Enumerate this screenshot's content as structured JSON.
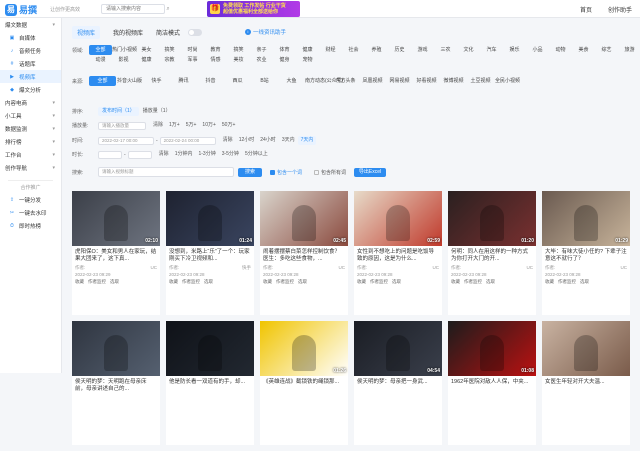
{
  "header": {
    "logo_text": "易撰",
    "slogan": "让创作更高效",
    "search_placeholder": "请输入搜索内容",
    "banner_line1": "免费领取 工作发帖 行业干货",
    "banner_line2": "超值优惠福利全部送给你",
    "nav": [
      "首页",
      "创作助手"
    ]
  },
  "sidebar": {
    "sections": [
      {
        "label": "爆文数据",
        "type": "head"
      },
      {
        "label": "自媒体",
        "type": "sub",
        "icon": "▣"
      },
      {
        "label": "音频任务",
        "type": "sub",
        "icon": "♪"
      },
      {
        "label": "话题库",
        "type": "sub",
        "icon": "#"
      },
      {
        "label": "视频库",
        "type": "sub",
        "icon": "▶",
        "active": true
      },
      {
        "label": "爆文分析",
        "type": "sub",
        "icon": "◆"
      },
      {
        "label": "内容电商",
        "type": "head"
      },
      {
        "label": "小工具",
        "type": "head"
      },
      {
        "label": "数据监测",
        "type": "head"
      },
      {
        "label": "排行榜",
        "type": "head"
      },
      {
        "label": "工作台",
        "type": "head"
      },
      {
        "label": "创作导航",
        "type": "head"
      }
    ],
    "partner_label": "合作推广",
    "partner_items": [
      "一键分发",
      "一键去水印",
      "即时热榜"
    ]
  },
  "tabs": {
    "items": [
      "视频库",
      "我的视频库"
    ],
    "mode_label": "简洁模式",
    "ad": "一线资讯助手"
  },
  "filters": {
    "category_label": "领域:",
    "categories": [
      "全部",
      "热门小视频",
      "美女",
      "搞笑",
      "时尚",
      "教育",
      "搞笑",
      "亲子",
      "体育",
      "健康",
      "财经",
      "社会",
      "养殖",
      "历史",
      "游戏",
      "三农",
      "文化",
      "汽车",
      "娱乐",
      "小品",
      "动物",
      "美食",
      "综艺",
      "旅游",
      "动漫",
      "影视",
      "健康",
      "宗教",
      "军事",
      "情感",
      "美妆",
      "农业",
      "健身",
      "宠物"
    ],
    "source_label": "来源:",
    "sources": [
      "全部",
      "抖音火山版",
      "快手",
      "腾讯",
      "抖音",
      "西瓜",
      "B站",
      "大鱼",
      "南方动态(公众号)",
      "东方头条",
      "凤凰视频",
      "网易视频",
      "好看视频",
      "微博视频",
      "土豆视频",
      "全民小视频"
    ],
    "sort_label": "排序:",
    "sort_opts": [
      "发布时间（1）",
      "播放量（1）"
    ],
    "play_label": "播放量:",
    "play_min": "请输入播放量",
    "play_opts": [
      "清除",
      "1万+",
      "5万+",
      "10万+",
      "50万+"
    ],
    "time_label": "时间:",
    "time_from": "2022-02-17 00:00",
    "time_to": "2022-02-24 00:00",
    "time_opts": [
      "清除",
      "12小时",
      "24小时",
      "3天内",
      "7天内"
    ],
    "dur_label": "时长:",
    "dur_from": "",
    "dur_to": "",
    "dur_opts": [
      "清除",
      "1分钟内",
      "1-3分钟",
      "3-5分钟",
      "5分钟以上"
    ],
    "kw_label": "搜索:",
    "kw_placeholder": "请输入视频标题",
    "search_btn": "搜索",
    "chk1": "包含一个词",
    "chk2": "包含所有词",
    "export_btn": "导出Excel"
  },
  "cards": [
    {
      "title": "虎阳保O：美女和男人在家玩，结果大团来了，这下真...",
      "dur": "02:10",
      "date": "2022-02-23 09:29",
      "src": "UC",
      "bg": "#3b3f48",
      "accent": "#6e7480"
    },
    {
      "title": "没想到，米路上“乐”了一个：玩家刚买下冷卫视频和...",
      "dur": "01:24",
      "date": "2022-02-23 09:28",
      "src": "快手",
      "bg": "#1e2230",
      "accent": "#3a4560"
    },
    {
      "title": "闹着摆摆蔡白菜怎样控制饮食？医生：多吃这些食物，...",
      "dur": "02:45",
      "date": "2022-02-23 09:28",
      "src": "UC",
      "bg": "#d9d4cc",
      "accent": "#8b4a3e"
    },
    {
      "title": "女性到不想吃上的问题是吃饭导致的原因，这是为什么...",
      "dur": "02:59",
      "date": "2022-02-23 09:28",
      "src": "UC",
      "bg": "#e7dbc9",
      "accent": "#c0392b"
    },
    {
      "title": "何明：同人在用这样的一种方式为你打开大门的开...",
      "dur": "01:20",
      "date": "2022-02-23 09:28",
      "src": "UC",
      "bg": "#2a2020",
      "accent": "#7a3030"
    },
    {
      "title": "大毕：有味大徒小任的? 下辈子注意这不就行了？",
      "dur": "01:29",
      "date": "2022-02-23 09:28",
      "src": "UC",
      "bg": "#6a5a50",
      "accent": "#c7b39a"
    },
    {
      "title": "侯天明的梦：天明跑在母亲床前，母亲讲述自己的...",
      "dur": "",
      "date": "",
      "src": "",
      "bg": "#2f3540",
      "accent": "#556070"
    },
    {
      "title": "他是防长看一双道有的手，却...",
      "dur": "",
      "date": "",
      "src": "",
      "bg": "#0f1218",
      "accent": "#222831"
    },
    {
      "title": "《英雄连战》截锁铁的绳锁那...",
      "dur": "01:26",
      "date": "",
      "src": "",
      "bg": "#f0c400",
      "accent": "#fff"
    },
    {
      "title": "侯天明的梦：母亲把一身武...",
      "dur": "04:54",
      "date": "",
      "src": "",
      "bg": "#1a1d24",
      "accent": "#3a3f4b"
    },
    {
      "title": "1962年医院对敌人人保，中夹...",
      "dur": "01:08",
      "date": "",
      "src": "",
      "bg": "#1c1c1c",
      "accent": "#b11"
    },
    {
      "title": "女医生年轻对开大夫温...",
      "dur": "",
      "date": "",
      "src": "",
      "bg": "#c9b3a2",
      "accent": "#7a5b4a"
    }
  ],
  "card_ui": {
    "author_prefix": "作者:",
    "fav": "收藏",
    "detail": "作者监控",
    "select": "选取"
  }
}
